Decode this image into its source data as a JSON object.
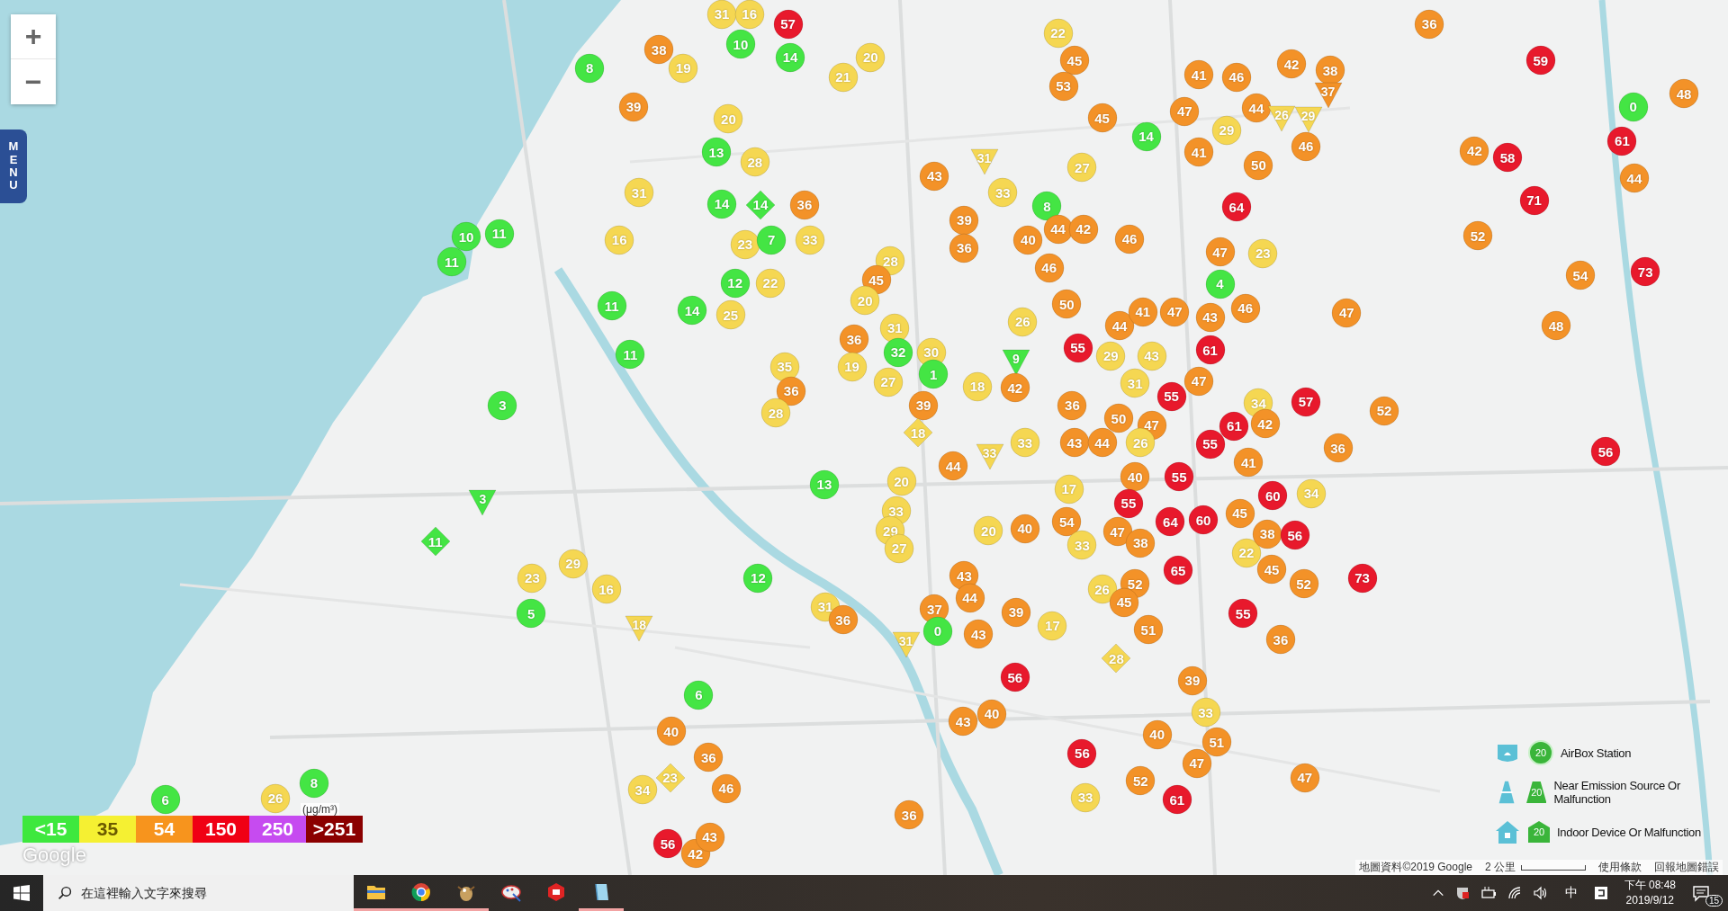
{
  "map": {
    "zoom_in": "+",
    "zoom_out": "−",
    "menu": "MENU",
    "unit": "(μg/m³)",
    "logo": "Google",
    "attribution": "地圖資料©2019 Google",
    "scale": "2 公里",
    "terms": "使用條款",
    "report": "回報地圖錯誤"
  },
  "legend": [
    {
      "label": "<15",
      "color": "#3ee83e"
    },
    {
      "label": "35",
      "color": "#f5f032"
    },
    {
      "label": "54",
      "color": "#f7941d"
    },
    {
      "label": "150",
      "color": "#f00014"
    },
    {
      "label": "250",
      "color": "#c64bf0"
    },
    {
      "label": ">251",
      "color": "#8b0000"
    }
  ],
  "station_types": [
    {
      "kind": "station",
      "sample": "20",
      "label": "AirBox Station"
    },
    {
      "kind": "emission",
      "sample": "20",
      "label": "Near Emission Source Or Malfunction"
    },
    {
      "kind": "indoor",
      "sample": "20",
      "label": "Indoor Device Or Malfunction"
    }
  ],
  "markers": [
    {
      "value": "31",
      "kind": "circle",
      "color": "#f5d752"
    },
    {
      "value": "16",
      "kind": "circle",
      "color": "#f5d752"
    },
    {
      "value": "57",
      "kind": "circle",
      "color": "#e8192c"
    },
    {
      "value": "36",
      "kind": "circle",
      "color": "#f39228"
    },
    {
      "value": "38",
      "kind": "circle",
      "color": "#f39228"
    },
    {
      "value": "10",
      "kind": "circle",
      "color": "#44e544"
    },
    {
      "value": "14",
      "kind": "circle",
      "color": "#44e544"
    },
    {
      "value": "20",
      "kind": "circle",
      "color": "#f5d752"
    },
    {
      "value": "22",
      "kind": "circle",
      "color": "#f5d752"
    },
    {
      "value": "45",
      "kind": "circle",
      "color": "#f39228"
    },
    {
      "value": "59",
      "kind": "circle",
      "color": "#e8192c"
    },
    {
      "value": "8",
      "kind": "circle",
      "color": "#44e544"
    },
    {
      "value": "19",
      "kind": "circle",
      "color": "#f5d752"
    },
    {
      "value": "21",
      "kind": "circle",
      "color": "#f5d752"
    },
    {
      "value": "53",
      "kind": "circle",
      "color": "#f39228"
    },
    {
      "value": "41",
      "kind": "circle",
      "color": "#f39228"
    },
    {
      "value": "46",
      "kind": "circle",
      "color": "#f39228"
    },
    {
      "value": "42",
      "kind": "circle",
      "color": "#f39228"
    },
    {
      "value": "38",
      "kind": "circle",
      "color": "#f39228"
    },
    {
      "value": "37",
      "kind": "triangle",
      "color": "#f39228"
    },
    {
      "value": "39",
      "kind": "circle",
      "color": "#f39228"
    },
    {
      "value": "20",
      "kind": "circle",
      "color": "#f5d752"
    },
    {
      "value": "45",
      "kind": "circle",
      "color": "#f39228"
    },
    {
      "value": "47",
      "kind": "circle",
      "color": "#f39228"
    },
    {
      "value": "44",
      "kind": "circle",
      "color": "#f39228"
    },
    {
      "value": "26",
      "kind": "triangle",
      "color": "#f5d752"
    },
    {
      "value": "29",
      "kind": "triangle",
      "color": "#f5d752"
    },
    {
      "value": "0",
      "kind": "circle",
      "color": "#44e544"
    },
    {
      "value": "48",
      "kind": "circle",
      "color": "#f39228"
    },
    {
      "value": "13",
      "kind": "circle",
      "color": "#44e544"
    },
    {
      "value": "14",
      "kind": "circle",
      "color": "#44e544"
    },
    {
      "value": "41",
      "kind": "circle",
      "color": "#f39228"
    },
    {
      "value": "29",
      "kind": "circle",
      "color": "#f5d752"
    },
    {
      "value": "46",
      "kind": "circle",
      "color": "#f39228"
    },
    {
      "value": "42",
      "kind": "circle",
      "color": "#f39228"
    },
    {
      "value": "61",
      "kind": "circle",
      "color": "#e8192c"
    },
    {
      "value": "28",
      "kind": "circle",
      "color": "#f5d752"
    },
    {
      "value": "43",
      "kind": "circle",
      "color": "#f39228"
    },
    {
      "value": "31",
      "kind": "triangle",
      "color": "#f5d752"
    },
    {
      "value": "27",
      "kind": "circle",
      "color": "#f5d752"
    },
    {
      "value": "50",
      "kind": "circle",
      "color": "#f39228"
    },
    {
      "value": "58",
      "kind": "circle",
      "color": "#e8192c"
    },
    {
      "value": "44",
      "kind": "circle",
      "color": "#f39228"
    },
    {
      "value": "31",
      "kind": "circle",
      "color": "#f5d752"
    },
    {
      "value": "14",
      "kind": "circle",
      "color": "#44e544"
    },
    {
      "value": "14",
      "kind": "diamond",
      "color": "#44e544"
    },
    {
      "value": "36",
      "kind": "circle",
      "color": "#f39228"
    },
    {
      "value": "33",
      "kind": "circle",
      "color": "#f5d752"
    },
    {
      "value": "8",
      "kind": "circle",
      "color": "#44e544"
    },
    {
      "value": "64",
      "kind": "circle",
      "color": "#e8192c"
    },
    {
      "value": "71",
      "kind": "circle",
      "color": "#e8192c"
    },
    {
      "value": "10",
      "kind": "circle",
      "color": "#44e544"
    },
    {
      "value": "11",
      "kind": "circle",
      "color": "#44e544"
    },
    {
      "value": "16",
      "kind": "circle",
      "color": "#f5d752"
    },
    {
      "value": "23",
      "kind": "circle",
      "color": "#f5d752"
    },
    {
      "value": "7",
      "kind": "circle",
      "color": "#44e544"
    },
    {
      "value": "33",
      "kind": "circle",
      "color": "#f5d752"
    },
    {
      "value": "39",
      "kind": "circle",
      "color": "#f39228"
    },
    {
      "value": "40",
      "kind": "circle",
      "color": "#f39228"
    },
    {
      "value": "44",
      "kind": "circle",
      "color": "#f39228"
    },
    {
      "value": "42",
      "kind": "circle",
      "color": "#f39228"
    },
    {
      "value": "46",
      "kind": "circle",
      "color": "#f39228"
    },
    {
      "value": "52",
      "kind": "circle",
      "color": "#f39228"
    },
    {
      "value": "11",
      "kind": "circle",
      "color": "#44e544"
    },
    {
      "value": "28",
      "kind": "circle",
      "color": "#f5d752"
    },
    {
      "value": "45",
      "kind": "circle",
      "color": "#f39228"
    },
    {
      "value": "20",
      "kind": "circle",
      "color": "#f5d752"
    },
    {
      "value": "36",
      "kind": "circle",
      "color": "#f39228"
    },
    {
      "value": "46",
      "kind": "circle",
      "color": "#f39228"
    },
    {
      "value": "47",
      "kind": "circle",
      "color": "#f39228"
    },
    {
      "value": "23",
      "kind": "circle",
      "color": "#f5d752"
    },
    {
      "value": "54",
      "kind": "circle",
      "color": "#f39228"
    },
    {
      "value": "73",
      "kind": "circle",
      "color": "#e8192c"
    },
    {
      "value": "11",
      "kind": "circle",
      "color": "#44e544"
    },
    {
      "value": "12",
      "kind": "circle",
      "color": "#44e544"
    },
    {
      "value": "22",
      "kind": "circle",
      "color": "#f5d752"
    },
    {
      "value": "50",
      "kind": "circle",
      "color": "#f39228"
    },
    {
      "value": "4",
      "kind": "circle",
      "color": "#44e544"
    },
    {
      "value": "14",
      "kind": "circle",
      "color": "#44e544"
    },
    {
      "value": "25",
      "kind": "circle",
      "color": "#f5d752"
    },
    {
      "value": "36",
      "kind": "circle",
      "color": "#f39228"
    },
    {
      "value": "31",
      "kind": "circle",
      "color": "#f5d752"
    },
    {
      "value": "26",
      "kind": "circle",
      "color": "#f5d752"
    },
    {
      "value": "44",
      "kind": "circle",
      "color": "#f39228"
    },
    {
      "value": "41",
      "kind": "circle",
      "color": "#f39228"
    },
    {
      "value": "47",
      "kind": "circle",
      "color": "#f39228"
    },
    {
      "value": "43",
      "kind": "circle",
      "color": "#f39228"
    },
    {
      "value": "46",
      "kind": "circle",
      "color": "#f39228"
    },
    {
      "value": "47",
      "kind": "circle",
      "color": "#f39228"
    },
    {
      "value": "48",
      "kind": "circle",
      "color": "#f39228"
    },
    {
      "value": "11",
      "kind": "circle",
      "color": "#44e544"
    },
    {
      "value": "35",
      "kind": "circle",
      "color": "#f5d752"
    },
    {
      "value": "19",
      "kind": "circle",
      "color": "#f5d752"
    },
    {
      "value": "32",
      "kind": "circle",
      "color": "#44e544"
    },
    {
      "value": "30",
      "kind": "circle",
      "color": "#f5d752"
    },
    {
      "value": "9",
      "kind": "triangle",
      "color": "#44e544"
    },
    {
      "value": "55",
      "kind": "circle",
      "color": "#e8192c"
    },
    {
      "value": "29",
      "kind": "circle",
      "color": "#f5d752"
    },
    {
      "value": "43",
      "kind": "circle",
      "color": "#f5d752"
    },
    {
      "value": "61",
      "kind": "circle",
      "color": "#e8192c"
    },
    {
      "value": "36",
      "kind": "circle",
      "color": "#f39228"
    },
    {
      "value": "27",
      "kind": "circle",
      "color": "#f5d752"
    },
    {
      "value": "1",
      "kind": "circle",
      "color": "#44e544"
    },
    {
      "value": "18",
      "kind": "circle",
      "color": "#f5d752"
    },
    {
      "value": "42",
      "kind": "circle",
      "color": "#f39228"
    },
    {
      "value": "31",
      "kind": "circle",
      "color": "#f5d752"
    },
    {
      "value": "55",
      "kind": "circle",
      "color": "#e8192c"
    },
    {
      "value": "47",
      "kind": "circle",
      "color": "#f39228"
    },
    {
      "value": "3",
      "kind": "circle",
      "color": "#44e544"
    },
    {
      "value": "28",
      "kind": "circle",
      "color": "#f5d752"
    },
    {
      "value": "39",
      "kind": "circle",
      "color": "#f39228"
    },
    {
      "value": "18",
      "kind": "diamond",
      "color": "#f5d752"
    },
    {
      "value": "33",
      "kind": "triangle",
      "color": "#f5d752"
    },
    {
      "value": "33",
      "kind": "circle",
      "color": "#f5d752"
    },
    {
      "value": "36",
      "kind": "circle",
      "color": "#f39228"
    },
    {
      "value": "43",
      "kind": "circle",
      "color": "#f39228"
    },
    {
      "value": "44",
      "kind": "circle",
      "color": "#f39228"
    },
    {
      "value": "50",
      "kind": "circle",
      "color": "#f39228"
    },
    {
      "value": "47",
      "kind": "circle",
      "color": "#f39228"
    },
    {
      "value": "26",
      "kind": "circle",
      "color": "#f5d752"
    },
    {
      "value": "55",
      "kind": "circle",
      "color": "#e8192c"
    },
    {
      "value": "61",
      "kind": "circle",
      "color": "#e8192c"
    },
    {
      "value": "34",
      "kind": "circle",
      "color": "#f5d752"
    },
    {
      "value": "42",
      "kind": "circle",
      "color": "#f39228"
    },
    {
      "value": "57",
      "kind": "circle",
      "color": "#e8192c"
    },
    {
      "value": "52",
      "kind": "circle",
      "color": "#f39228"
    },
    {
      "value": "36",
      "kind": "circle",
      "color": "#f39228"
    },
    {
      "value": "56",
      "kind": "circle",
      "color": "#e8192c"
    },
    {
      "value": "13",
      "kind": "circle",
      "color": "#44e544"
    },
    {
      "value": "20",
      "kind": "circle",
      "color": "#f5d752"
    },
    {
      "value": "44",
      "kind": "circle",
      "color": "#f39228"
    },
    {
      "value": "17",
      "kind": "circle",
      "color": "#f5d752"
    },
    {
      "value": "40",
      "kind": "circle",
      "color": "#f39228"
    },
    {
      "value": "55",
      "kind": "circle",
      "color": "#e8192c"
    },
    {
      "value": "41",
      "kind": "circle",
      "color": "#f39228"
    },
    {
      "value": "3",
      "kind": "triangle",
      "color": "#44e544"
    },
    {
      "value": "33",
      "kind": "circle",
      "color": "#f5d752"
    },
    {
      "value": "29",
      "kind": "circle",
      "color": "#f5d752"
    },
    {
      "value": "54",
      "kind": "circle",
      "color": "#f39228"
    },
    {
      "value": "55",
      "kind": "circle",
      "color": "#e8192c"
    },
    {
      "value": "64",
      "kind": "circle",
      "color": "#e8192c"
    },
    {
      "value": "60",
      "kind": "circle",
      "color": "#e8192c"
    },
    {
      "value": "45",
      "kind": "circle",
      "color": "#f39228"
    },
    {
      "value": "60",
      "kind": "circle",
      "color": "#e8192c"
    },
    {
      "value": "34",
      "kind": "circle",
      "color": "#f5d752"
    },
    {
      "value": "11",
      "kind": "diamond",
      "color": "#44e544"
    },
    {
      "value": "27",
      "kind": "circle",
      "color": "#f5d752"
    },
    {
      "value": "20",
      "kind": "circle",
      "color": "#f5d752"
    },
    {
      "value": "40",
      "kind": "circle",
      "color": "#f39228"
    },
    {
      "value": "33",
      "kind": "circle",
      "color": "#f5d752"
    },
    {
      "value": "47",
      "kind": "circle",
      "color": "#f39228"
    },
    {
      "value": "38",
      "kind": "circle",
      "color": "#f39228"
    },
    {
      "value": "22",
      "kind": "circle",
      "color": "#f5d752"
    },
    {
      "value": "38",
      "kind": "circle",
      "color": "#f39228"
    },
    {
      "value": "56",
      "kind": "circle",
      "color": "#e8192c"
    },
    {
      "value": "23",
      "kind": "circle",
      "color": "#f5d752"
    },
    {
      "value": "29",
      "kind": "circle",
      "color": "#f5d752"
    },
    {
      "value": "12",
      "kind": "circle",
      "color": "#44e544"
    },
    {
      "value": "43",
      "kind": "circle",
      "color": "#f39228"
    },
    {
      "value": "26",
      "kind": "circle",
      "color": "#f5d752"
    },
    {
      "value": "52",
      "kind": "circle",
      "color": "#f39228"
    },
    {
      "value": "45",
      "kind": "circle",
      "color": "#f39228"
    },
    {
      "value": "65",
      "kind": "circle",
      "color": "#e8192c"
    },
    {
      "value": "45",
      "kind": "circle",
      "color": "#f39228"
    },
    {
      "value": "52",
      "kind": "circle",
      "color": "#f39228"
    },
    {
      "value": "73",
      "kind": "circle",
      "color": "#e8192c"
    },
    {
      "value": "5",
      "kind": "circle",
      "color": "#44e544"
    },
    {
      "value": "16",
      "kind": "circle",
      "color": "#f5d752"
    },
    {
      "value": "31",
      "kind": "circle",
      "color": "#f5d752"
    },
    {
      "value": "37",
      "kind": "circle",
      "color": "#f39228"
    },
    {
      "value": "44",
      "kind": "circle",
      "color": "#f39228"
    },
    {
      "value": "39",
      "kind": "circle",
      "color": "#f39228"
    },
    {
      "value": "55",
      "kind": "circle",
      "color": "#e8192c"
    },
    {
      "value": "18",
      "kind": "triangle",
      "color": "#f5d752"
    },
    {
      "value": "36",
      "kind": "circle",
      "color": "#f39228"
    },
    {
      "value": "31",
      "kind": "triangle",
      "color": "#f5d752"
    },
    {
      "value": "0",
      "kind": "circle",
      "color": "#44e544"
    },
    {
      "value": "43",
      "kind": "circle",
      "color": "#f39228"
    },
    {
      "value": "17",
      "kind": "circle",
      "color": "#f5d752"
    },
    {
      "value": "51",
      "kind": "circle",
      "color": "#f39228"
    },
    {
      "value": "36",
      "kind": "circle",
      "color": "#f39228"
    },
    {
      "value": "56",
      "kind": "circle",
      "color": "#e8192c"
    },
    {
      "value": "28",
      "kind": "diamond",
      "color": "#f5d752"
    },
    {
      "value": "6",
      "kind": "circle",
      "color": "#44e544"
    },
    {
      "value": "39",
      "kind": "circle",
      "color": "#f39228"
    },
    {
      "value": "40",
      "kind": "circle",
      "color": "#f39228"
    },
    {
      "value": "43",
      "kind": "circle",
      "color": "#f39228"
    },
    {
      "value": "40",
      "kind": "circle",
      "color": "#f39228"
    },
    {
      "value": "40",
      "kind": "circle",
      "color": "#f39228"
    },
    {
      "value": "33",
      "kind": "circle",
      "color": "#f5d752"
    },
    {
      "value": "36",
      "kind": "circle",
      "color": "#f39228"
    },
    {
      "value": "56",
      "kind": "circle",
      "color": "#e8192c"
    },
    {
      "value": "47",
      "kind": "circle",
      "color": "#f39228"
    },
    {
      "value": "51",
      "kind": "circle",
      "color": "#f39228"
    },
    {
      "value": "6",
      "kind": "circle",
      "color": "#44e544"
    },
    {
      "value": "26",
      "kind": "circle",
      "color": "#f5d752"
    },
    {
      "value": "8",
      "kind": "circle",
      "color": "#44e544"
    },
    {
      "value": "34",
      "kind": "circle",
      "color": "#f5d752"
    },
    {
      "value": "23",
      "kind": "diamond",
      "color": "#f5d752"
    },
    {
      "value": "46",
      "kind": "circle",
      "color": "#f39228"
    },
    {
      "value": "33",
      "kind": "circle",
      "color": "#f5d752"
    },
    {
      "value": "52",
      "kind": "circle",
      "color": "#f39228"
    },
    {
      "value": "61",
      "kind": "circle",
      "color": "#e8192c"
    },
    {
      "value": "47",
      "kind": "circle",
      "color": "#f39228"
    },
    {
      "value": "36",
      "kind": "circle",
      "color": "#f39228"
    },
    {
      "value": "56",
      "kind": "circle",
      "color": "#e8192c"
    },
    {
      "value": "42",
      "kind": "circle",
      "color": "#f39228"
    },
    {
      "value": "43",
      "kind": "circle",
      "color": "#f39228"
    }
  ],
  "taskbar": {
    "search_placeholder": "在這裡輸入文字來搜尋",
    "apps": [
      {
        "kind": "folder",
        "running": true
      },
      {
        "kind": "browser",
        "running": true
      },
      {
        "kind": "bird",
        "running": true
      },
      {
        "kind": "paint",
        "running": false
      },
      {
        "kind": "sketch",
        "running": false
      },
      {
        "kind": "notepad",
        "running": true
      }
    ],
    "ime": "中",
    "time": "下午 08:48",
    "date": "2019/9/12",
    "notifications": "15"
  }
}
